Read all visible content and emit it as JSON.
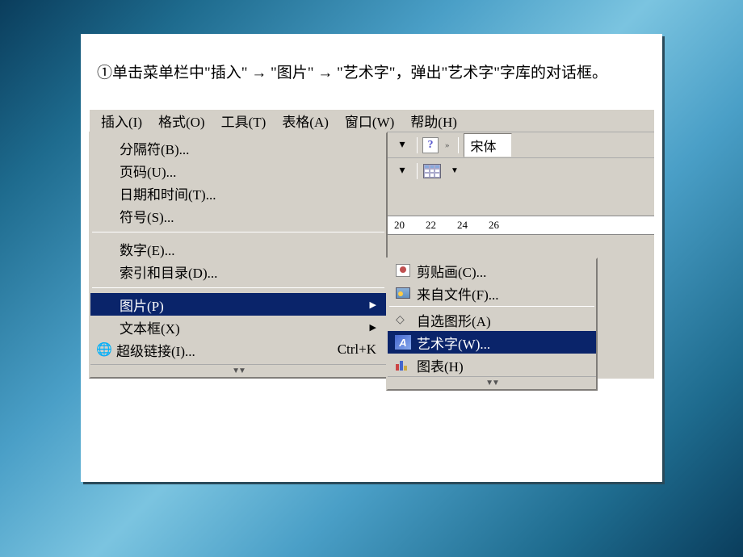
{
  "instruction": "①单击菜单栏中\"插入\" → \"图片\" → \"艺术字\"，弹出\"艺术字\"字库的对话框。",
  "menubar": {
    "insert": "插入(I)",
    "format": "格式(O)",
    "tools": "工具(T)",
    "table": "表格(A)",
    "window": "窗口(W)",
    "help": "帮助(H)"
  },
  "insert_menu": {
    "separator": "分隔符(B)...",
    "page_number": "页码(U)...",
    "date_time": "日期和时间(T)...",
    "symbol": "符号(S)...",
    "number": "数字(E)...",
    "index_toc": "索引和目录(D)...",
    "picture": "图片(P)",
    "textbox": "文本框(X)",
    "hyperlink": "超级链接(I)...",
    "hyperlink_shortcut": "Ctrl+K"
  },
  "picture_submenu": {
    "clipart": "剪贴画(C)...",
    "from_file": "来自文件(F)...",
    "autoshapes": "自选图形(A)",
    "wordart": "艺术字(W)...",
    "chart": "图表(H)"
  },
  "toolbar": {
    "font_name": "宋体"
  },
  "ruler": {
    "m20": "20",
    "m22": "22",
    "m24": "24",
    "m26": "26"
  }
}
